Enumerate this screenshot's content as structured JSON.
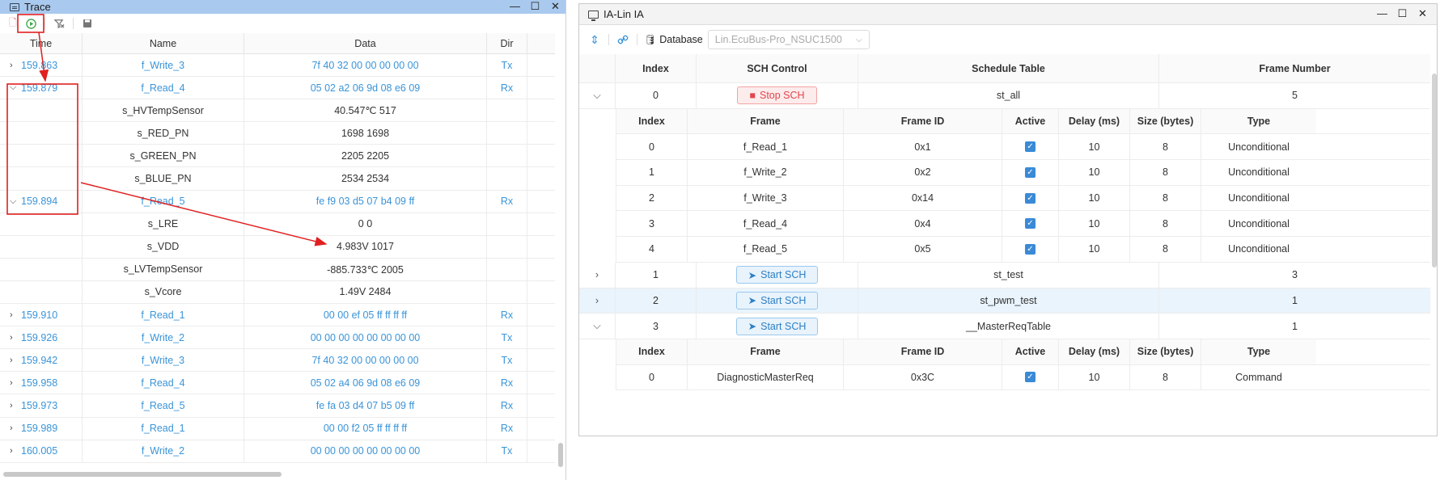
{
  "trace": {
    "title": "Trace",
    "columns": [
      "Time",
      "Name",
      "Data",
      "Dir"
    ],
    "rows": [
      {
        "time": "159.863",
        "name": "f_Write_3",
        "data": "7f 40 32 00 00 00 00 00",
        "dir": "Tx",
        "kind": "frame",
        "expanded": false
      },
      {
        "time": "159.879",
        "name": "f_Read_4",
        "data": "05 02 a2 06 9d 08 e6 09",
        "dir": "Rx",
        "kind": "frame",
        "expanded": true
      },
      {
        "time": "",
        "name": "s_HVTempSensor",
        "data": "40.547℃  517",
        "dir": "",
        "kind": "signal"
      },
      {
        "time": "",
        "name": "s_RED_PN",
        "data": "1698  1698",
        "dir": "",
        "kind": "signal"
      },
      {
        "time": "",
        "name": "s_GREEN_PN",
        "data": "2205  2205",
        "dir": "",
        "kind": "signal"
      },
      {
        "time": "",
        "name": "s_BLUE_PN",
        "data": "2534  2534",
        "dir": "",
        "kind": "signal"
      },
      {
        "time": "159.894",
        "name": "f_Read_5",
        "data": "fe f9 03 d5 07 b4 09 ff",
        "dir": "Rx",
        "kind": "frame",
        "expanded": true
      },
      {
        "time": "",
        "name": "s_LRE",
        "data": "0  0",
        "dir": "",
        "kind": "signal"
      },
      {
        "time": "",
        "name": "s_VDD",
        "data": "4.983V  1017",
        "dir": "",
        "kind": "signal"
      },
      {
        "time": "",
        "name": "s_LVTempSensor",
        "data": "-885.733℃  2005",
        "dir": "",
        "kind": "signal"
      },
      {
        "time": "",
        "name": "s_Vcore",
        "data": "1.49V  2484",
        "dir": "",
        "kind": "signal"
      },
      {
        "time": "159.910",
        "name": "f_Read_1",
        "data": "00 00 ef 05 ff ff ff ff",
        "dir": "Rx",
        "kind": "frame",
        "expanded": false
      },
      {
        "time": "159.926",
        "name": "f_Write_2",
        "data": "00 00 00 00 00 00 00 00",
        "dir": "Tx",
        "kind": "frame",
        "expanded": false
      },
      {
        "time": "159.942",
        "name": "f_Write_3",
        "data": "7f 40 32 00 00 00 00 00",
        "dir": "Tx",
        "kind": "frame",
        "expanded": false
      },
      {
        "time": "159.958",
        "name": "f_Read_4",
        "data": "05 02 a4 06 9d 08 e6 09",
        "dir": "Rx",
        "kind": "frame",
        "expanded": false
      },
      {
        "time": "159.973",
        "name": "f_Read_5",
        "data": "fe fa 03 d4 07 b5 09 ff",
        "dir": "Rx",
        "kind": "frame",
        "expanded": false
      },
      {
        "time": "159.989",
        "name": "f_Read_1",
        "data": "00 00 f2 05 ff ff ff ff",
        "dir": "Rx",
        "kind": "frame",
        "expanded": false
      },
      {
        "time": "160.005",
        "name": "f_Write_2",
        "data": "00 00 00 00 00 00 00 00",
        "dir": "Tx",
        "kind": "frame",
        "expanded": false
      }
    ]
  },
  "ialin": {
    "title": "IA-Lin IA",
    "database_label": "Database",
    "database_value": "Lin.EcuBus-Pro_NSUC1500",
    "columns": [
      "Index",
      "SCH Control",
      "Schedule Table",
      "Frame Number"
    ],
    "sub_columns": [
      "Index",
      "Frame",
      "Frame ID",
      "Active",
      "Delay (ms)",
      "Size (bytes)",
      "Type"
    ],
    "schedules": [
      {
        "index": "0",
        "control": "Stop SCH",
        "running": true,
        "table": "st_all",
        "frames": "5",
        "expanded": true,
        "sub_rows": [
          {
            "index": "0",
            "frame": "f_Read_1",
            "id": "0x1",
            "delay": "10",
            "size": "8",
            "type": "Unconditional"
          },
          {
            "index": "1",
            "frame": "f_Write_2",
            "id": "0x2",
            "delay": "10",
            "size": "8",
            "type": "Unconditional"
          },
          {
            "index": "2",
            "frame": "f_Write_3",
            "id": "0x14",
            "delay": "10",
            "size": "8",
            "type": "Unconditional"
          },
          {
            "index": "3",
            "frame": "f_Read_4",
            "id": "0x4",
            "delay": "10",
            "size": "8",
            "type": "Unconditional"
          },
          {
            "index": "4",
            "frame": "f_Read_5",
            "id": "0x5",
            "delay": "10",
            "size": "8",
            "type": "Unconditional"
          }
        ]
      },
      {
        "index": "1",
        "control": "Start SCH",
        "running": false,
        "table": "st_test",
        "frames": "3",
        "expanded": false,
        "sub_rows": []
      },
      {
        "index": "2",
        "control": "Start SCH",
        "running": false,
        "table": "st_pwm_test",
        "frames": "1",
        "expanded": false,
        "selected": true,
        "sub_rows": []
      },
      {
        "index": "3",
        "control": "Start SCH",
        "running": false,
        "table": "__MasterReqTable",
        "frames": "1",
        "expanded": true,
        "sub_rows": [
          {
            "index": "0",
            "frame": "DiagnosticMasterReq",
            "id": "0x3C",
            "delay": "10",
            "size": "8",
            "type": "Command"
          }
        ]
      }
    ]
  },
  "colors": {
    "accent": "#3a94d8",
    "annotation": "#e02020",
    "title_active": "#a9c9ee",
    "stop": "#e0464d",
    "start": "#2d7fc4"
  }
}
